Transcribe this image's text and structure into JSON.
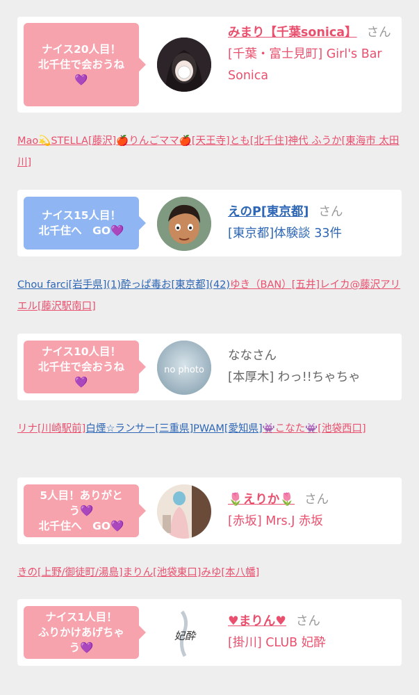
{
  "cards": [
    {
      "bubble": [
        "ナイス20人目！",
        "北千住で会おうね",
        "💜"
      ],
      "name": "みまり【千葉sonica】",
      "san": "さん",
      "sub": "[千葉・富士見町] Girl's Bar Sonica",
      "avatar": "girl-photo"
    },
    {
      "bubble": [
        "ナイス15人目！",
        "北千住へ　GO💜"
      ],
      "name": "えのP[東京都]",
      "san": "さん",
      "sub": "[東京都]体験談 33件",
      "avatar": "cartoon-man"
    },
    {
      "bubble": [
        "ナイス10人目！",
        "北千住で会おうね",
        "💜"
      ],
      "name": "ななさん",
      "san": "",
      "sub": "[本厚木] わっ!!ちゃちゃ",
      "avatar": "no photo"
    },
    {
      "bubble": [
        "5人目！ありがと",
        "う💜",
        "北千住へ　GO💜"
      ],
      "name": "🌷えりか🌷",
      "san": "さん",
      "sub": "[赤坂] Mrs.J 赤坂",
      "avatar": "woman-photo"
    },
    {
      "bubble": [
        "ナイス1人目！",
        "ふりかけあげちゃ",
        "う💜"
      ],
      "name": "♥まりん♥",
      "san": "さん",
      "sub": "[掛川] CLUB 妃酔",
      "avatar": "妃酔"
    }
  ],
  "link_rows": [
    [
      {
        "t": "Mao💫STELLA[藤沢]",
        "c": "p"
      },
      {
        "t": "🍎りんごママ🍎[天王寺]",
        "c": "p"
      },
      {
        "t": "とも[北千住]",
        "c": "p"
      },
      {
        "t": "神代 ふうか[東海市 太田川]",
        "c": "p"
      }
    ],
    [
      {
        "t": "Chou farci[岩手県](1)",
        "c": "b"
      },
      {
        "t": "酔っぱ毒お[東京都](42)",
        "c": "b"
      },
      {
        "t": "ゆき（BAN）[五井]",
        "c": "p"
      },
      {
        "t": "レイカ@藤沢アリエル[藤沢駅南口]",
        "c": "p"
      }
    ],
    [
      {
        "t": "リナ[川崎駅前]",
        "c": "p"
      },
      {
        "t": "白煙☆ランサー[三重県]",
        "c": "b"
      },
      {
        "t": "PWAM[愛知県]",
        "c": "b"
      },
      {
        "t": "👾こなた👾[池袋西口]",
        "c": "p"
      }
    ],
    [
      {
        "t": "きの[上野/御徒町/湯島]",
        "c": "p"
      },
      {
        "t": "まりん[池袋東口]",
        "c": "p"
      },
      {
        "t": "みゆ[本八幡]",
        "c": "p"
      }
    ]
  ]
}
